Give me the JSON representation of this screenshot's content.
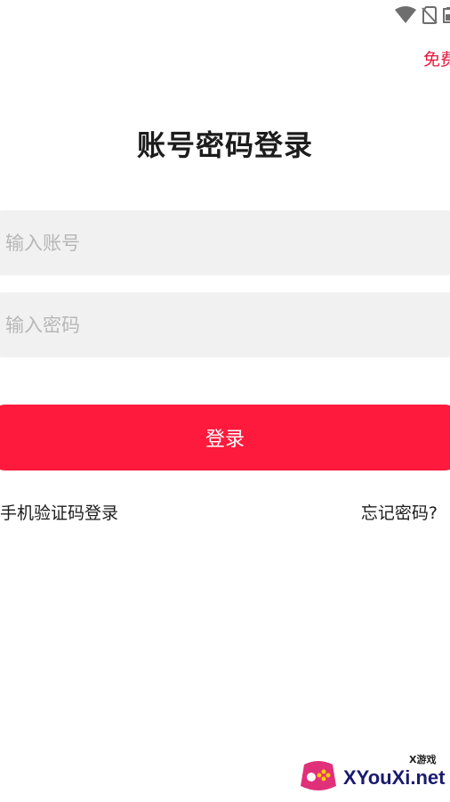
{
  "status_bar": {
    "icons": [
      "wifi-icon",
      "no-sim-icon",
      "battery-icon"
    ]
  },
  "header": {
    "top_link": "免费"
  },
  "login_form": {
    "title": "账号密码登录",
    "account_placeholder": "输入账号",
    "password_placeholder": "输入密码",
    "submit_label": "登录",
    "sms_login_label": "手机验证码登录",
    "forgot_password_label": "忘记密码?"
  },
  "watermark": {
    "main_text": "XYouXi.net",
    "sub_text": "X游戏"
  },
  "colors": {
    "accent": "#fe1a3d",
    "link": "#e8173c",
    "input_bg": "#f1f1f1",
    "placeholder": "#b7b7b7",
    "text": "#1c1c1c"
  }
}
